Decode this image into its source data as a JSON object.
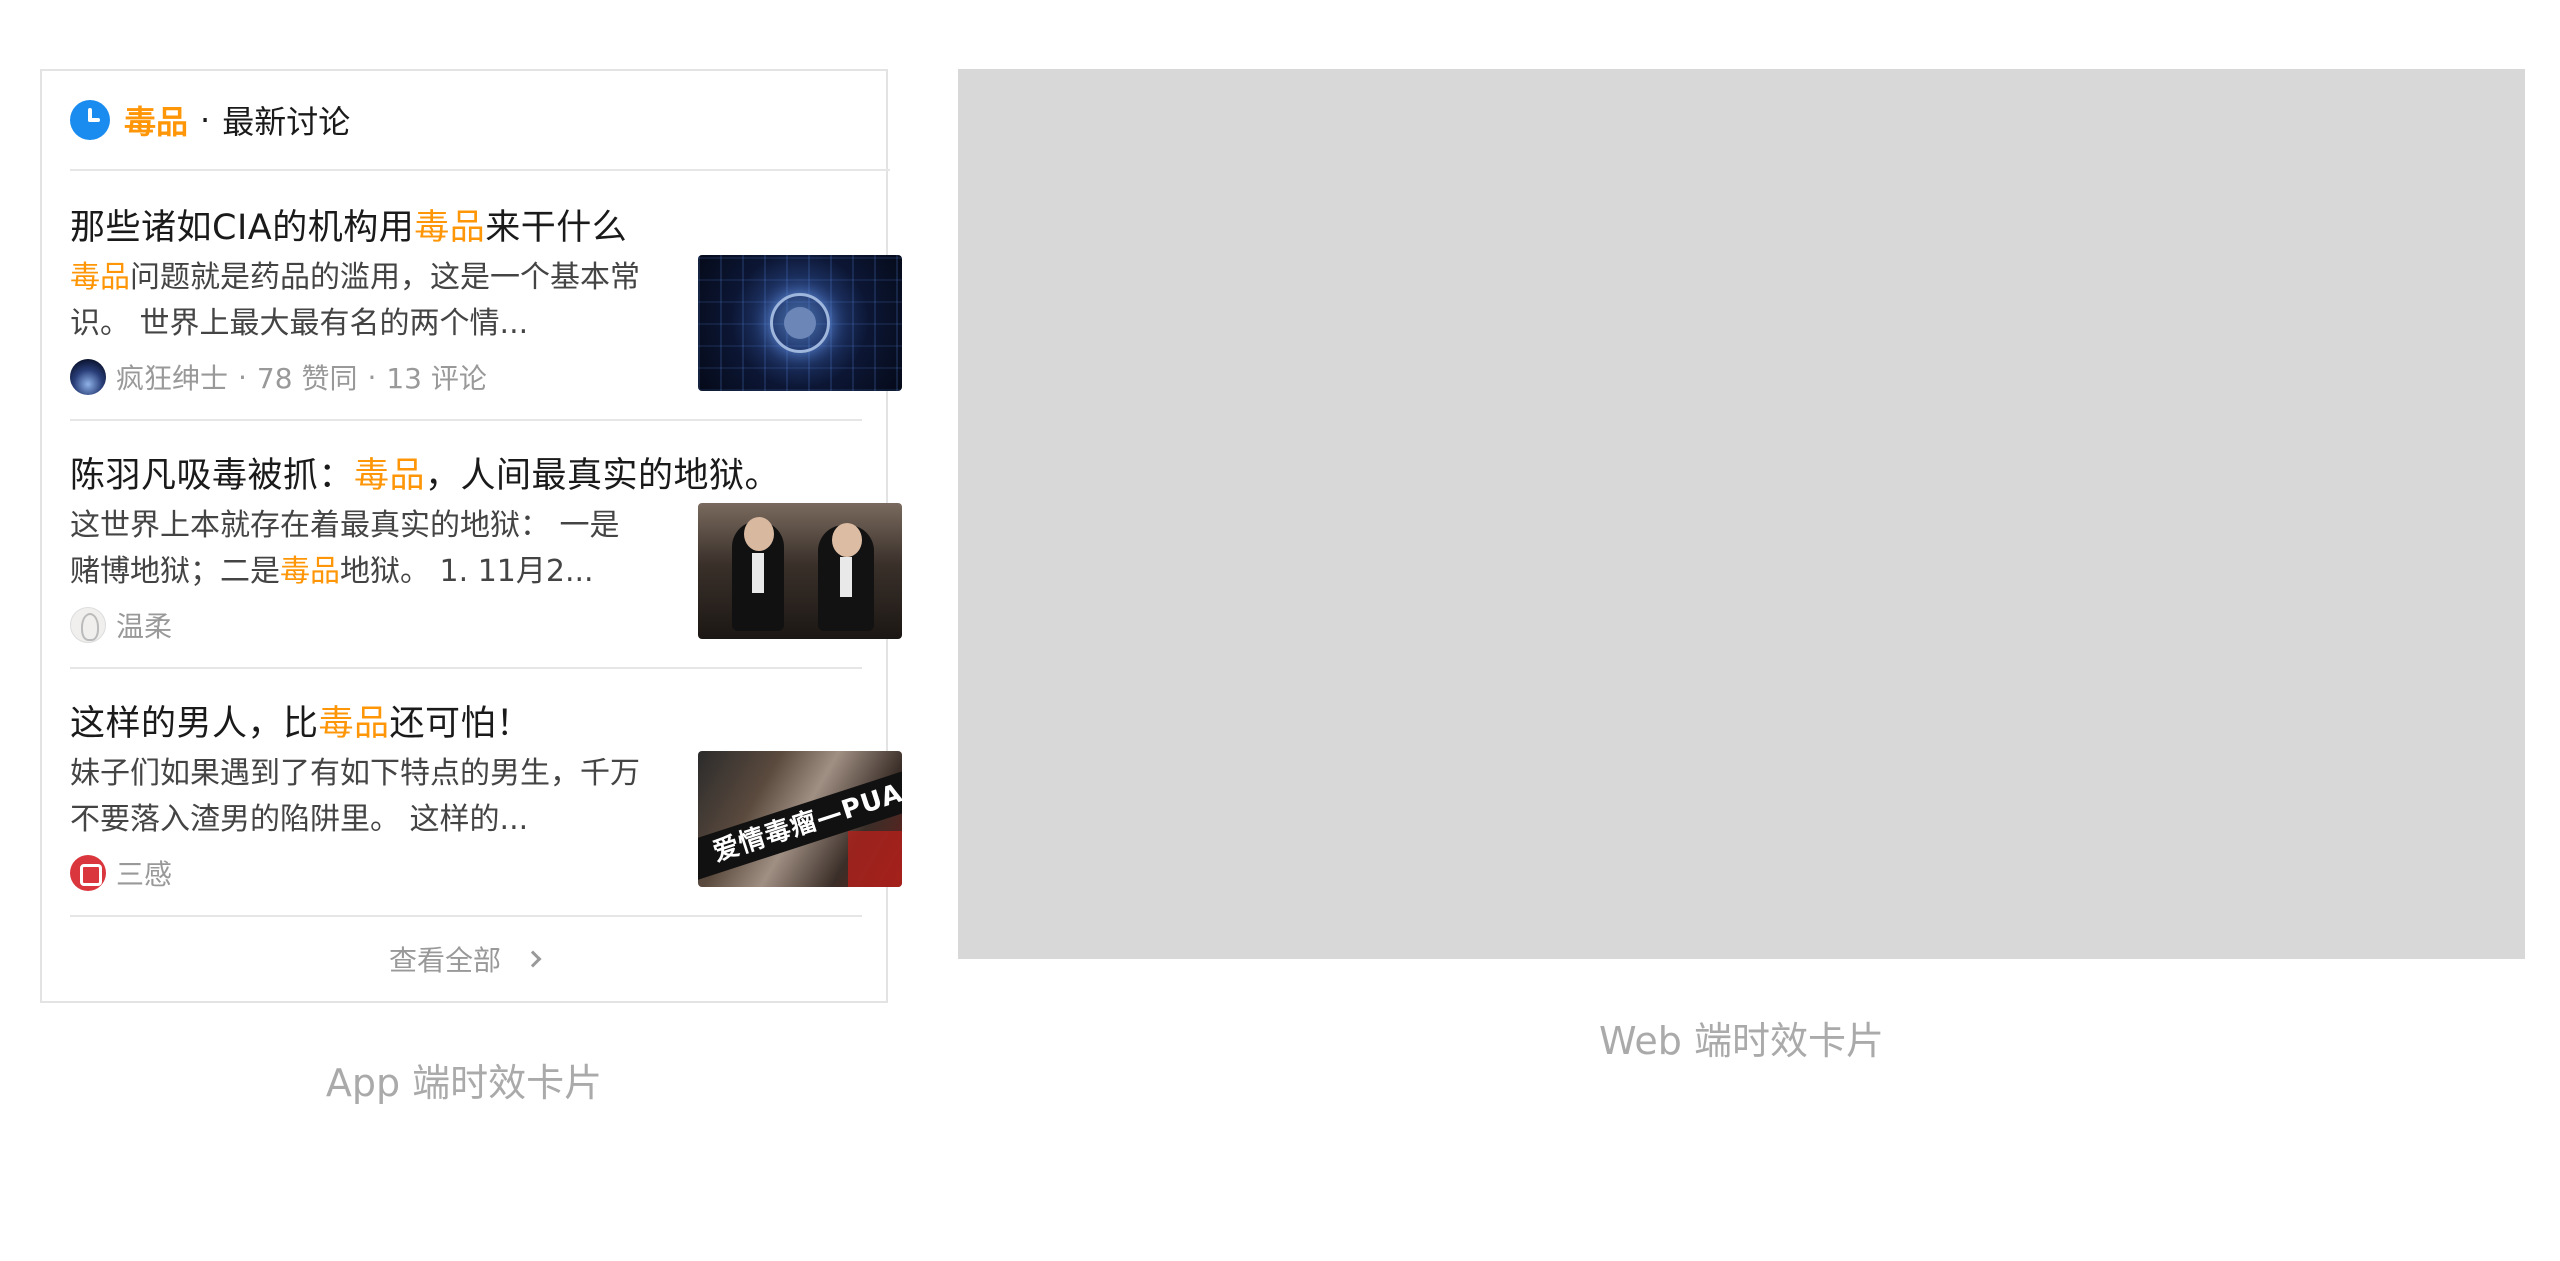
{
  "app_card": {
    "header": {
      "topic": "毒品",
      "dot": "·",
      "label": "最新讨论"
    },
    "items": [
      {
        "title_parts": [
          "那些诸如CIA的机构用",
          "毒品",
          "来干什么"
        ],
        "excerpt_parts": [
          "",
          "毒品",
          "问题就是药品的滥用，这是一个基本常识。 世界上最大最有名的两个情..."
        ],
        "author": "疯狂绅士",
        "likes": "78 赞同",
        "comments": "13 评论",
        "thumbnail": "cia-seal-image"
      },
      {
        "title_parts": [
          "陈羽凡吸毒被抓：",
          "毒品",
          "，人间最真实的地狱。"
        ],
        "excerpt_parts": [
          "这世界上本就存在着最真实的地狱： 一是赌博地狱；二是",
          "毒品",
          "地狱。 1. 11月2..."
        ],
        "author": "温柔",
        "thumbnail": "two-men-photo"
      },
      {
        "title_parts": [
          "这样的男人，比",
          "毒品",
          "还可怕！"
        ],
        "excerpt_parts": [
          "妹子们如果遇到了有如下特点的男生，千万不要落入渣男的陷阱里。 这样的...",
          "",
          ""
        ],
        "author": "三感",
        "thumbnail": "pua-poster",
        "thumbnail_text": "爱情毒瘤—PUA"
      }
    ],
    "view_all": "查看全部"
  },
  "app_caption": "App 端时效卡片",
  "web_caption": "Web 端时效卡片",
  "colors": {
    "highlight": "#ff9607",
    "clock_icon": "#1a8cf0",
    "web_placeholder": "#d8d8d8",
    "caption": "#aaaaaa"
  }
}
